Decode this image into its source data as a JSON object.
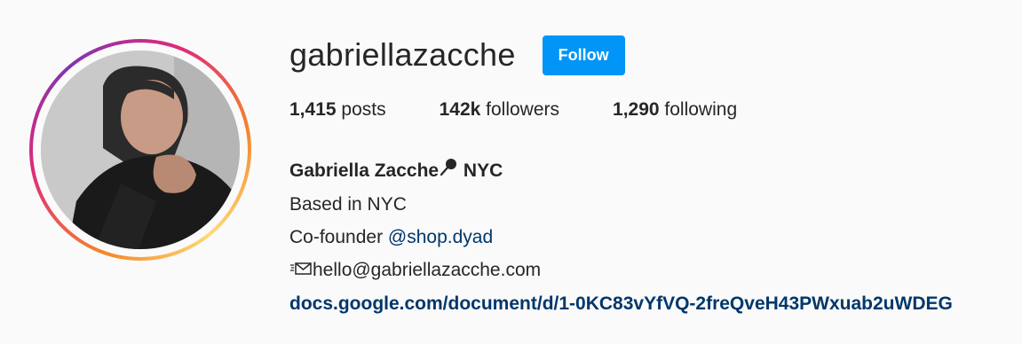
{
  "profile": {
    "username": "gabriellazacche",
    "follow_label": "Follow"
  },
  "stats": {
    "posts_count": "1,415",
    "posts_label": " posts",
    "followers_count": "142k",
    "followers_label": " followers",
    "following_count": "1,290",
    "following_label": " following"
  },
  "bio": {
    "full_name": "Gabriella Zacche",
    "name_suffix": " NYC",
    "line_location": "Based in NYC",
    "cofounder_prefix": "Co-founder ",
    "cofounder_mention": "@shop.dyad",
    "email": "hello@gabriellazacche.com",
    "link": "docs.google.com/document/d/1-0KC83vYfVQ-2freQveH43PWxuab2uWDEG"
  },
  "icons": {
    "name_icon": "pin-icon",
    "email_icon": "envelope-icon"
  },
  "colors": {
    "follow_button": "#0095f6",
    "link": "#00376b"
  }
}
